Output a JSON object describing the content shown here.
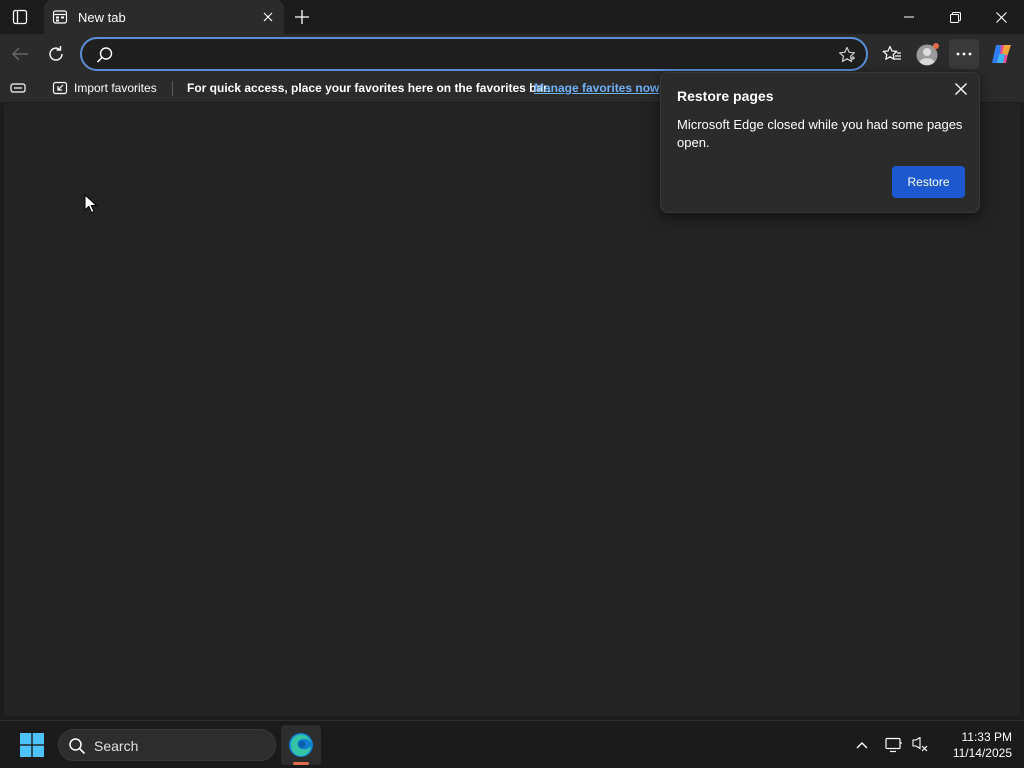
{
  "window": {
    "tab_title": "New tab"
  },
  "addressbar": {
    "value": "",
    "placeholder": ""
  },
  "favorites_bar": {
    "import_label": "Import favorites",
    "message": "For quick access, place your favorites here on the favorites bar.",
    "manage_link": "Manage favorites now"
  },
  "restore_popup": {
    "title": "Restore pages",
    "message": "Microsoft Edge closed while you had some pages open.",
    "button_label": "Restore"
  },
  "taskbar": {
    "search_label": "Search",
    "time": "11:33 PM",
    "date": "11/14/2025"
  },
  "icons": [
    "tab-actions-icon",
    "new-tab-favicon",
    "close-icon",
    "plus-icon",
    "minimize-icon",
    "restore-icon",
    "back-icon",
    "refresh-icon",
    "search-icon",
    "star-icon",
    "favorites-icon",
    "profile-icon",
    "more-icon",
    "copilot-icon",
    "import-icon",
    "windows-icon",
    "edge-icon",
    "chevron-up-icon",
    "display-icon",
    "network-icon"
  ],
  "colors": {
    "accent": "#1c59d0",
    "link": "#6fb0f7",
    "address_border": "#5a8fd8",
    "background": "#1c1c1c"
  }
}
